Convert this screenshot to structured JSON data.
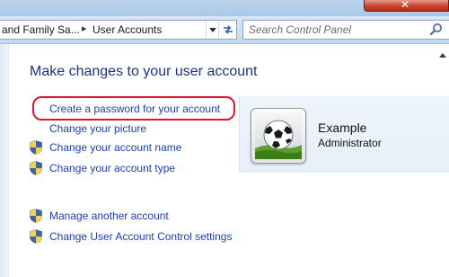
{
  "address_bar": {
    "breadcrumbs": [
      "and Family Sa...",
      "User Accounts"
    ]
  },
  "search": {
    "placeholder": "Search Control Panel"
  },
  "page": {
    "title": "Make changes to your user account"
  },
  "tasks": [
    {
      "label": "Create a password for your account",
      "shield": false,
      "icon": ""
    },
    {
      "label": "Change your picture",
      "shield": false,
      "icon": ""
    },
    {
      "label": "Change your account name",
      "shield": true,
      "icon": "uac-shield-icon"
    },
    {
      "label": "Change your account type",
      "shield": true,
      "icon": "uac-shield-icon"
    }
  ],
  "other_tasks": [
    {
      "label": "Manage another account",
      "shield": true,
      "icon": "uac-shield-icon"
    },
    {
      "label": "Change User Account Control settings",
      "shield": true,
      "icon": "uac-shield-icon"
    }
  ],
  "account": {
    "name": "Example",
    "role": "Administrator",
    "picture": "soccer-ball-icon"
  },
  "colors": {
    "link": "#1e3dba",
    "title": "#1e3287",
    "highlight": "#e0142d"
  }
}
